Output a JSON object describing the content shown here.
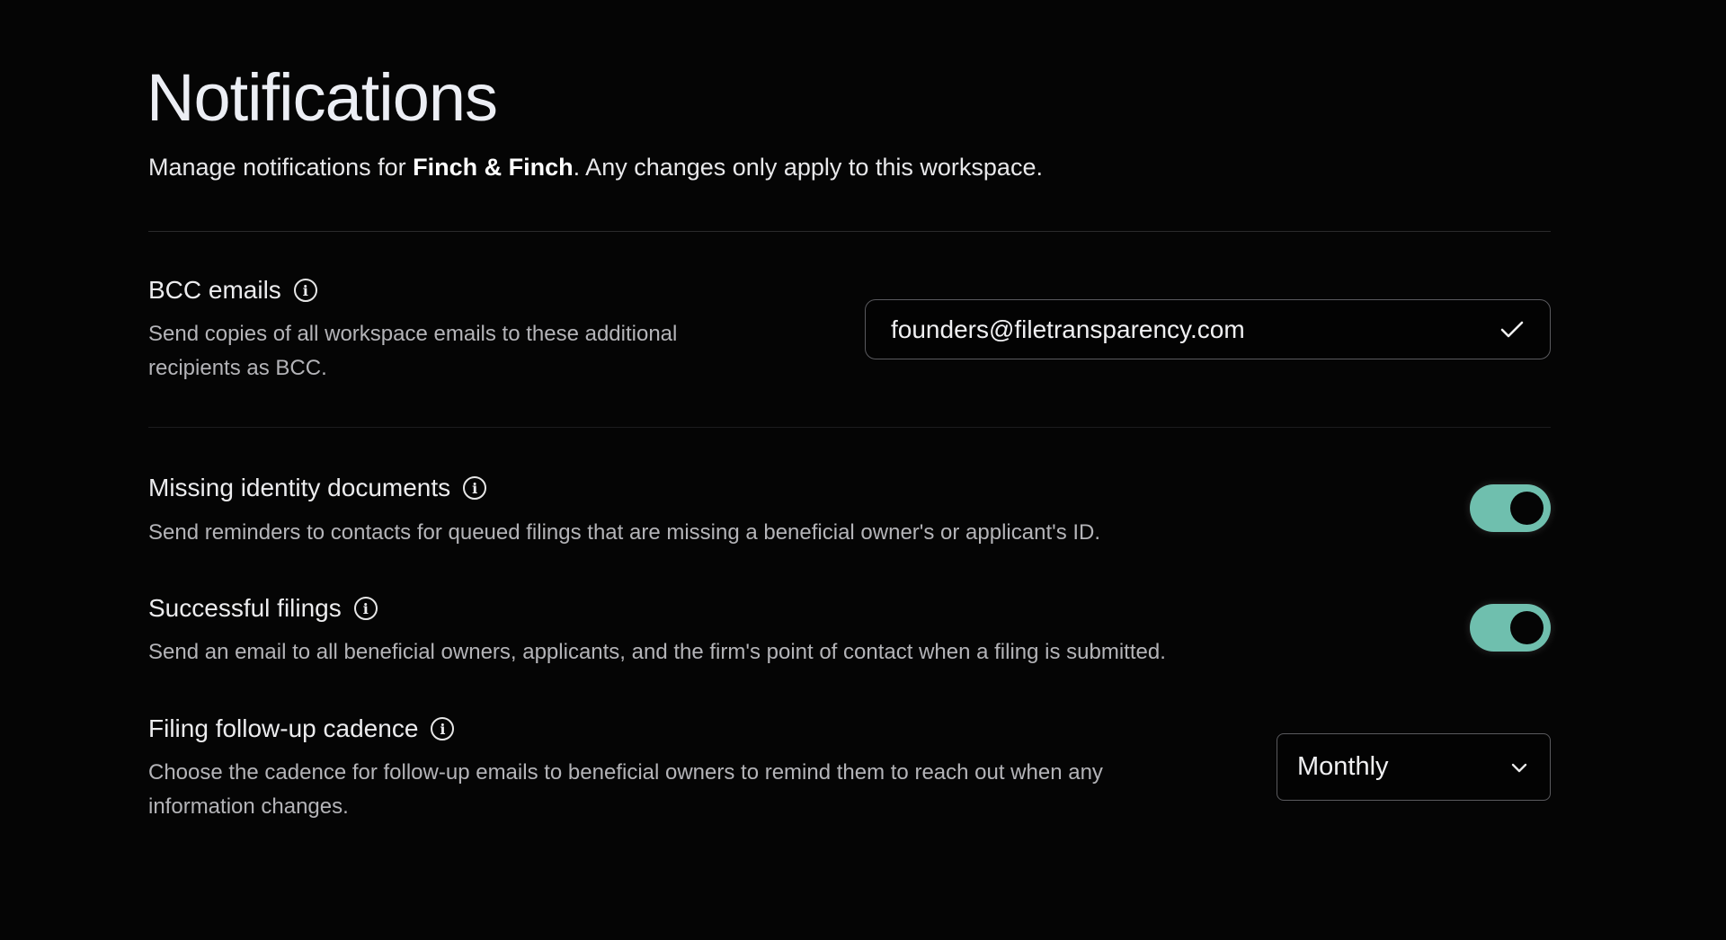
{
  "header": {
    "title": "Notifications",
    "subtitle_prefix": "Manage notifications for ",
    "workspace_name": "Finch & Finch",
    "subtitle_suffix": ". Any changes only apply to this workspace."
  },
  "settings": {
    "bcc": {
      "label": "BCC emails",
      "description_line1": "Send copies of all workspace emails to these additional",
      "description_line2": "recipients as BCC.",
      "value": "founders@filetransparency.com",
      "icon": "check-icon"
    },
    "missing_identity": {
      "label": "Missing identity documents",
      "description": "Send reminders to contacts for queued filings that are missing a beneficial owner's or applicant's ID.",
      "enabled": true
    },
    "successful_filings": {
      "label": "Successful filings",
      "description": "Send an email to all beneficial owners, applicants, and the firm's point of contact when a filing is submitted.",
      "enabled": true
    },
    "cadence": {
      "label": "Filing follow-up cadence",
      "description_line1": "Choose the cadence for follow-up emails to beneficial owners to remind them to reach out when any",
      "description_line2": "information changes.",
      "selected": "Monthly"
    }
  },
  "colors": {
    "toggle_on": "#6fbfae",
    "background": "#050505"
  }
}
